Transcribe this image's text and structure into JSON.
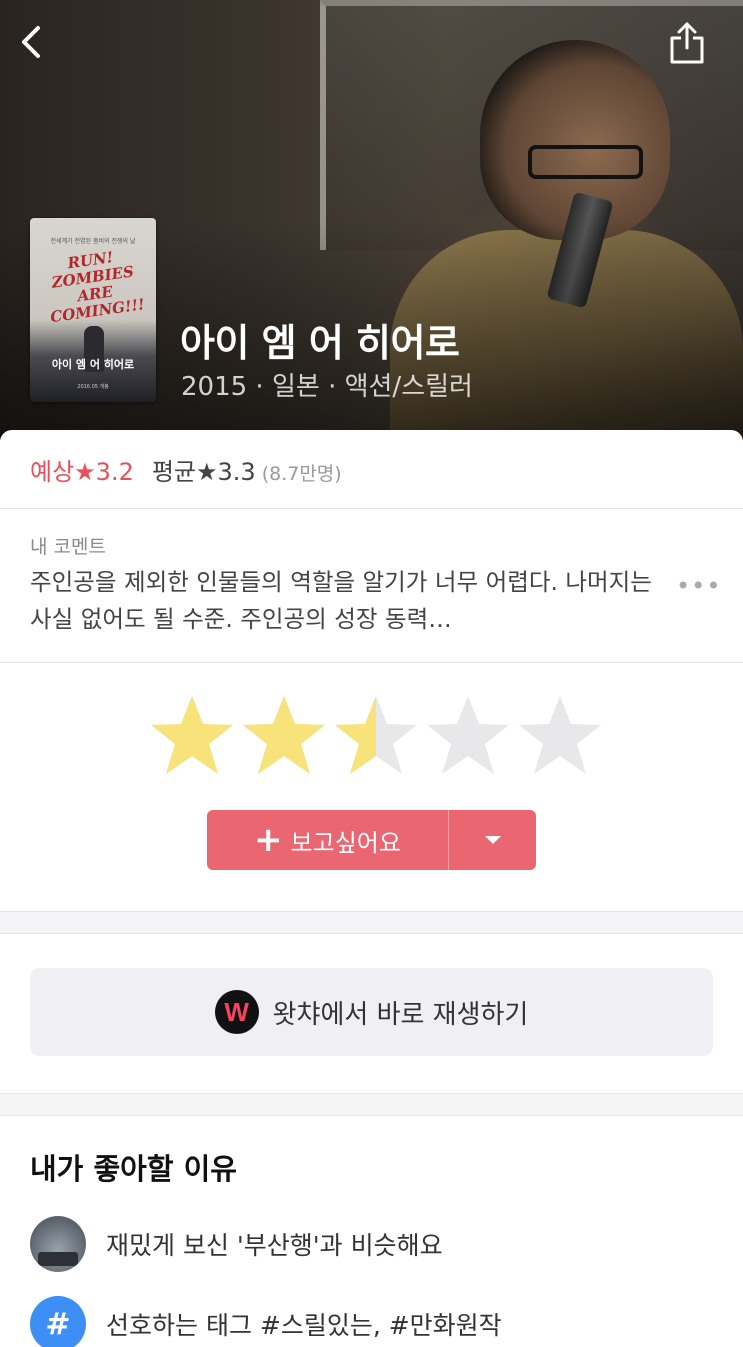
{
  "header": {
    "back_icon": "chevron-left-icon",
    "share_icon": "share-icon"
  },
  "poster": {
    "top_text": "전세계가 전염된 좀비의 전쟁의 날",
    "tagline": "RUN! ZOMBIES ARE COMING!!!",
    "title": "아이 엠 어 히어로",
    "credit": "2016.05 개봉"
  },
  "movie": {
    "title": "아이 엠 어 히어로",
    "meta": "2015 · 일본 · 액션/스릴러"
  },
  "rating": {
    "predicted": "예상★3.2",
    "average": "평균★3.3",
    "count": "(8.7만명)"
  },
  "comment": {
    "label": "내 코멘트",
    "text": "주인공을 제외한 인물들의 역할을 알기가 너무 어렵다. 나머지는 사실 없어도 될 수준. 주인공의 성장 동력…",
    "more_label": "•••"
  },
  "my_rating": {
    "value": 2.5,
    "max": 5,
    "filled_color": "#f8e27a",
    "empty_color": "#e8e8ea"
  },
  "wishlist": {
    "label": "보고싶어요",
    "plus": "+",
    "color": "#ea6670"
  },
  "play": {
    "logo": "W",
    "label": "왓챠에서 바로 재생하기"
  },
  "reasons": {
    "title": "내가 좋아할 이유",
    "items": [
      {
        "icon": "movie-thumbnail-icon",
        "text": "재밌게 보신 '부산행'과 비슷해요"
      },
      {
        "icon": "hash-icon",
        "glyph": "#",
        "text": "선호하는 태그 #스릴있는, #만화원작"
      }
    ]
  }
}
